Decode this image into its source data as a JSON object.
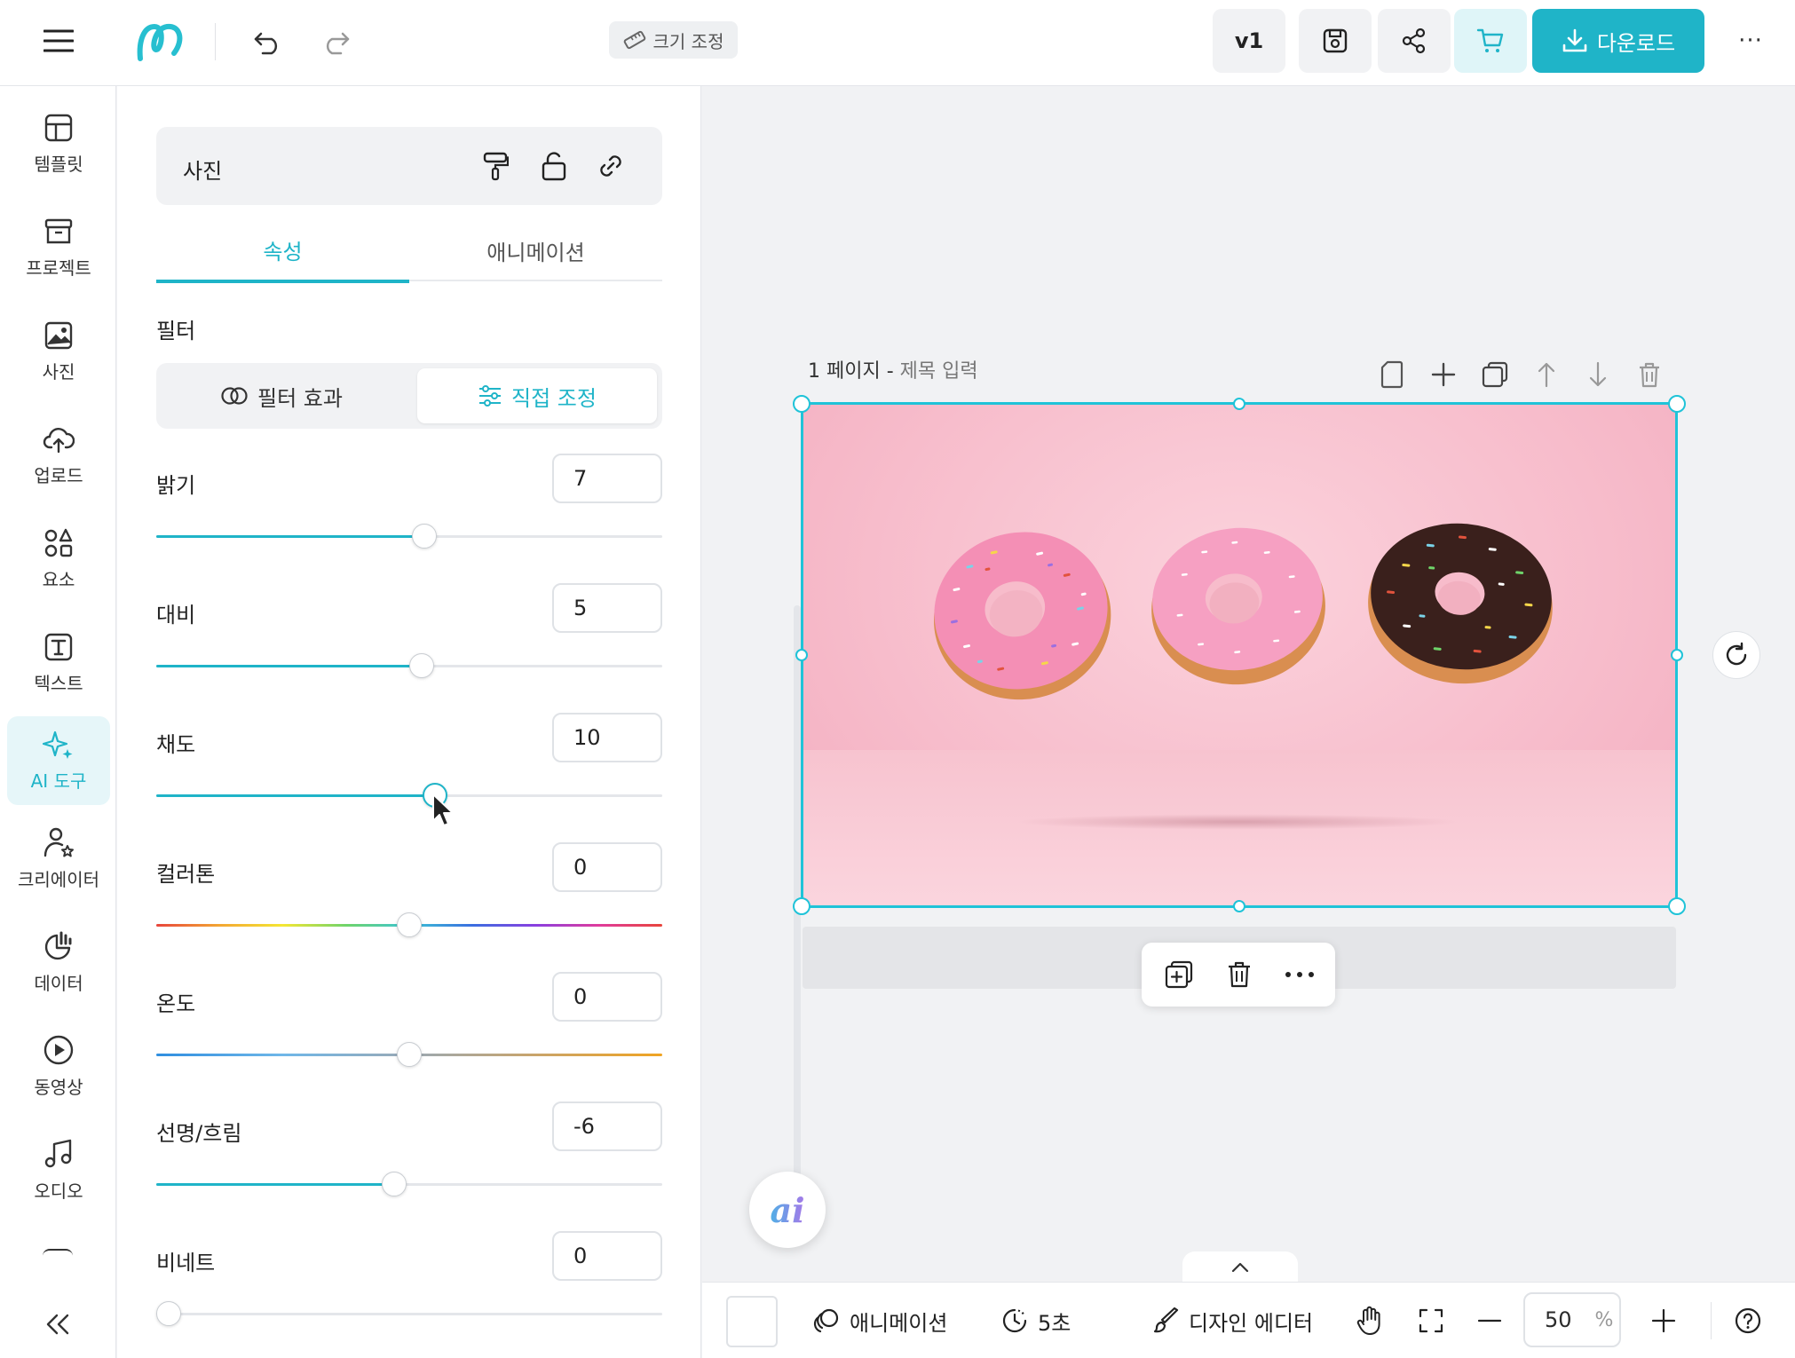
{
  "topbar": {
    "resize_label": "크기 조정",
    "version_label": "v1",
    "download_label": "다운로드",
    "more_label": "···"
  },
  "leftnav": {
    "items": [
      {
        "label": "템플릿",
        "icon": "template-icon"
      },
      {
        "label": "프로젝트",
        "icon": "project-icon"
      },
      {
        "label": "사진",
        "icon": "photo-icon"
      },
      {
        "label": "업로드",
        "icon": "upload-icon"
      },
      {
        "label": "요소",
        "icon": "elements-icon"
      },
      {
        "label": "텍스트",
        "icon": "text-icon"
      },
      {
        "label": "AI 도구",
        "icon": "ai-sparkle-icon",
        "active": true
      },
      {
        "label": "크리에이터",
        "icon": "creator-icon"
      },
      {
        "label": "데이터",
        "icon": "chart-icon"
      },
      {
        "label": "동영상",
        "icon": "video-icon"
      },
      {
        "label": "오디오",
        "icon": "audio-icon"
      }
    ]
  },
  "panel": {
    "header_title": "사진",
    "tabs": [
      {
        "label": "속성",
        "active": true
      },
      {
        "label": "애니메이션",
        "active": false
      }
    ],
    "filter_section_title": "필터",
    "filter_modes": [
      {
        "label": "필터 효과",
        "active": false
      },
      {
        "label": "직접 조정",
        "active": true
      }
    ],
    "controls": [
      {
        "label": "밝기",
        "value": "7",
        "position": 0.53
      },
      {
        "label": "대비",
        "value": "5",
        "position": 0.525
      },
      {
        "label": "채도",
        "value": "10",
        "position": 0.55
      },
      {
        "label": "컬러톤",
        "value": "0",
        "position": 0.5
      },
      {
        "label": "온도",
        "value": "0",
        "position": 0.5
      },
      {
        "label": "선명/흐림",
        "value": "-6",
        "position": 0.47
      },
      {
        "label": "비네트",
        "value": "0",
        "position": 0.0
      }
    ]
  },
  "canvas": {
    "page_number": "1 페이지",
    "page_separator": "-",
    "page_title_placeholder": "제목 입력"
  },
  "bottombar": {
    "animation_label": "애니메이션",
    "duration_label": "5초",
    "design_editor_label": "디자인 에디터",
    "zoom_value": "50",
    "zoom_unit": "%"
  },
  "colors": {
    "accent": "#1fb4c8",
    "selection": "#1fc3d8",
    "canvas_bg": "#f7bccb"
  }
}
